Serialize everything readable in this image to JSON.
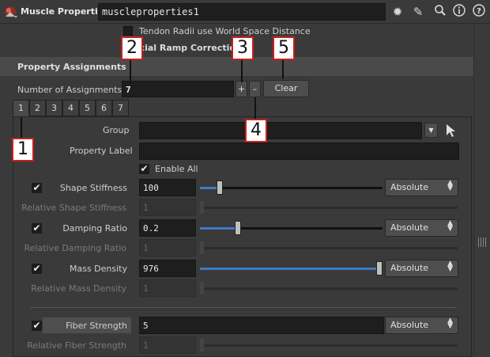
{
  "header": {
    "node_type": "Muscle Properties",
    "node_name": "muscleproperties1",
    "icons": [
      "muscle-node-icon",
      "gear-icon",
      "brush-icon",
      "search-icon",
      "info-icon",
      "help-icon"
    ]
  },
  "top_options": {
    "tendon_label": "Tendon Radii use World Space Distance",
    "ramp_label": "xial Ramp Correction"
  },
  "section": {
    "title": "Property Assignments",
    "num_assign_label": "Number of Assignments",
    "num_assign_value": "7",
    "plus": "+",
    "minus": "–",
    "clear": "Clear"
  },
  "tabs": [
    "1",
    "2",
    "3",
    "4",
    "5",
    "6",
    "7"
  ],
  "panel": {
    "group_label": "Group",
    "group_value": "",
    "prop_label": "Property Label",
    "prop_value": "",
    "enable_all": "Enable All",
    "rows": [
      {
        "label": "Shape Stiffness",
        "value": "100",
        "mode": "Absolute",
        "rel_label": "Relative Shape Stiffness",
        "rel_value": "1",
        "level": 0.1
      },
      {
        "label": "Damping Ratio",
        "value": "0.2",
        "mode": "Absolute",
        "rel_label": "Relative Damping Ratio",
        "rel_value": "1",
        "level": 0.2
      },
      {
        "label": "Mass Density",
        "value": "976",
        "mode": "Absolute",
        "rel_label": "Relative Mass Density",
        "rel_value": "1",
        "level": 1.0
      },
      {
        "label": "Fiber Strength",
        "value": "5",
        "mode": "Absolute",
        "rel_label": "Relative Fiber Strength",
        "rel_value": "1",
        "level": null
      }
    ]
  },
  "callouts": [
    "1",
    "2",
    "3",
    "4",
    "5"
  ],
  "colors": {
    "accent": "#3d7bc6",
    "callout_border": "#c8201e"
  }
}
